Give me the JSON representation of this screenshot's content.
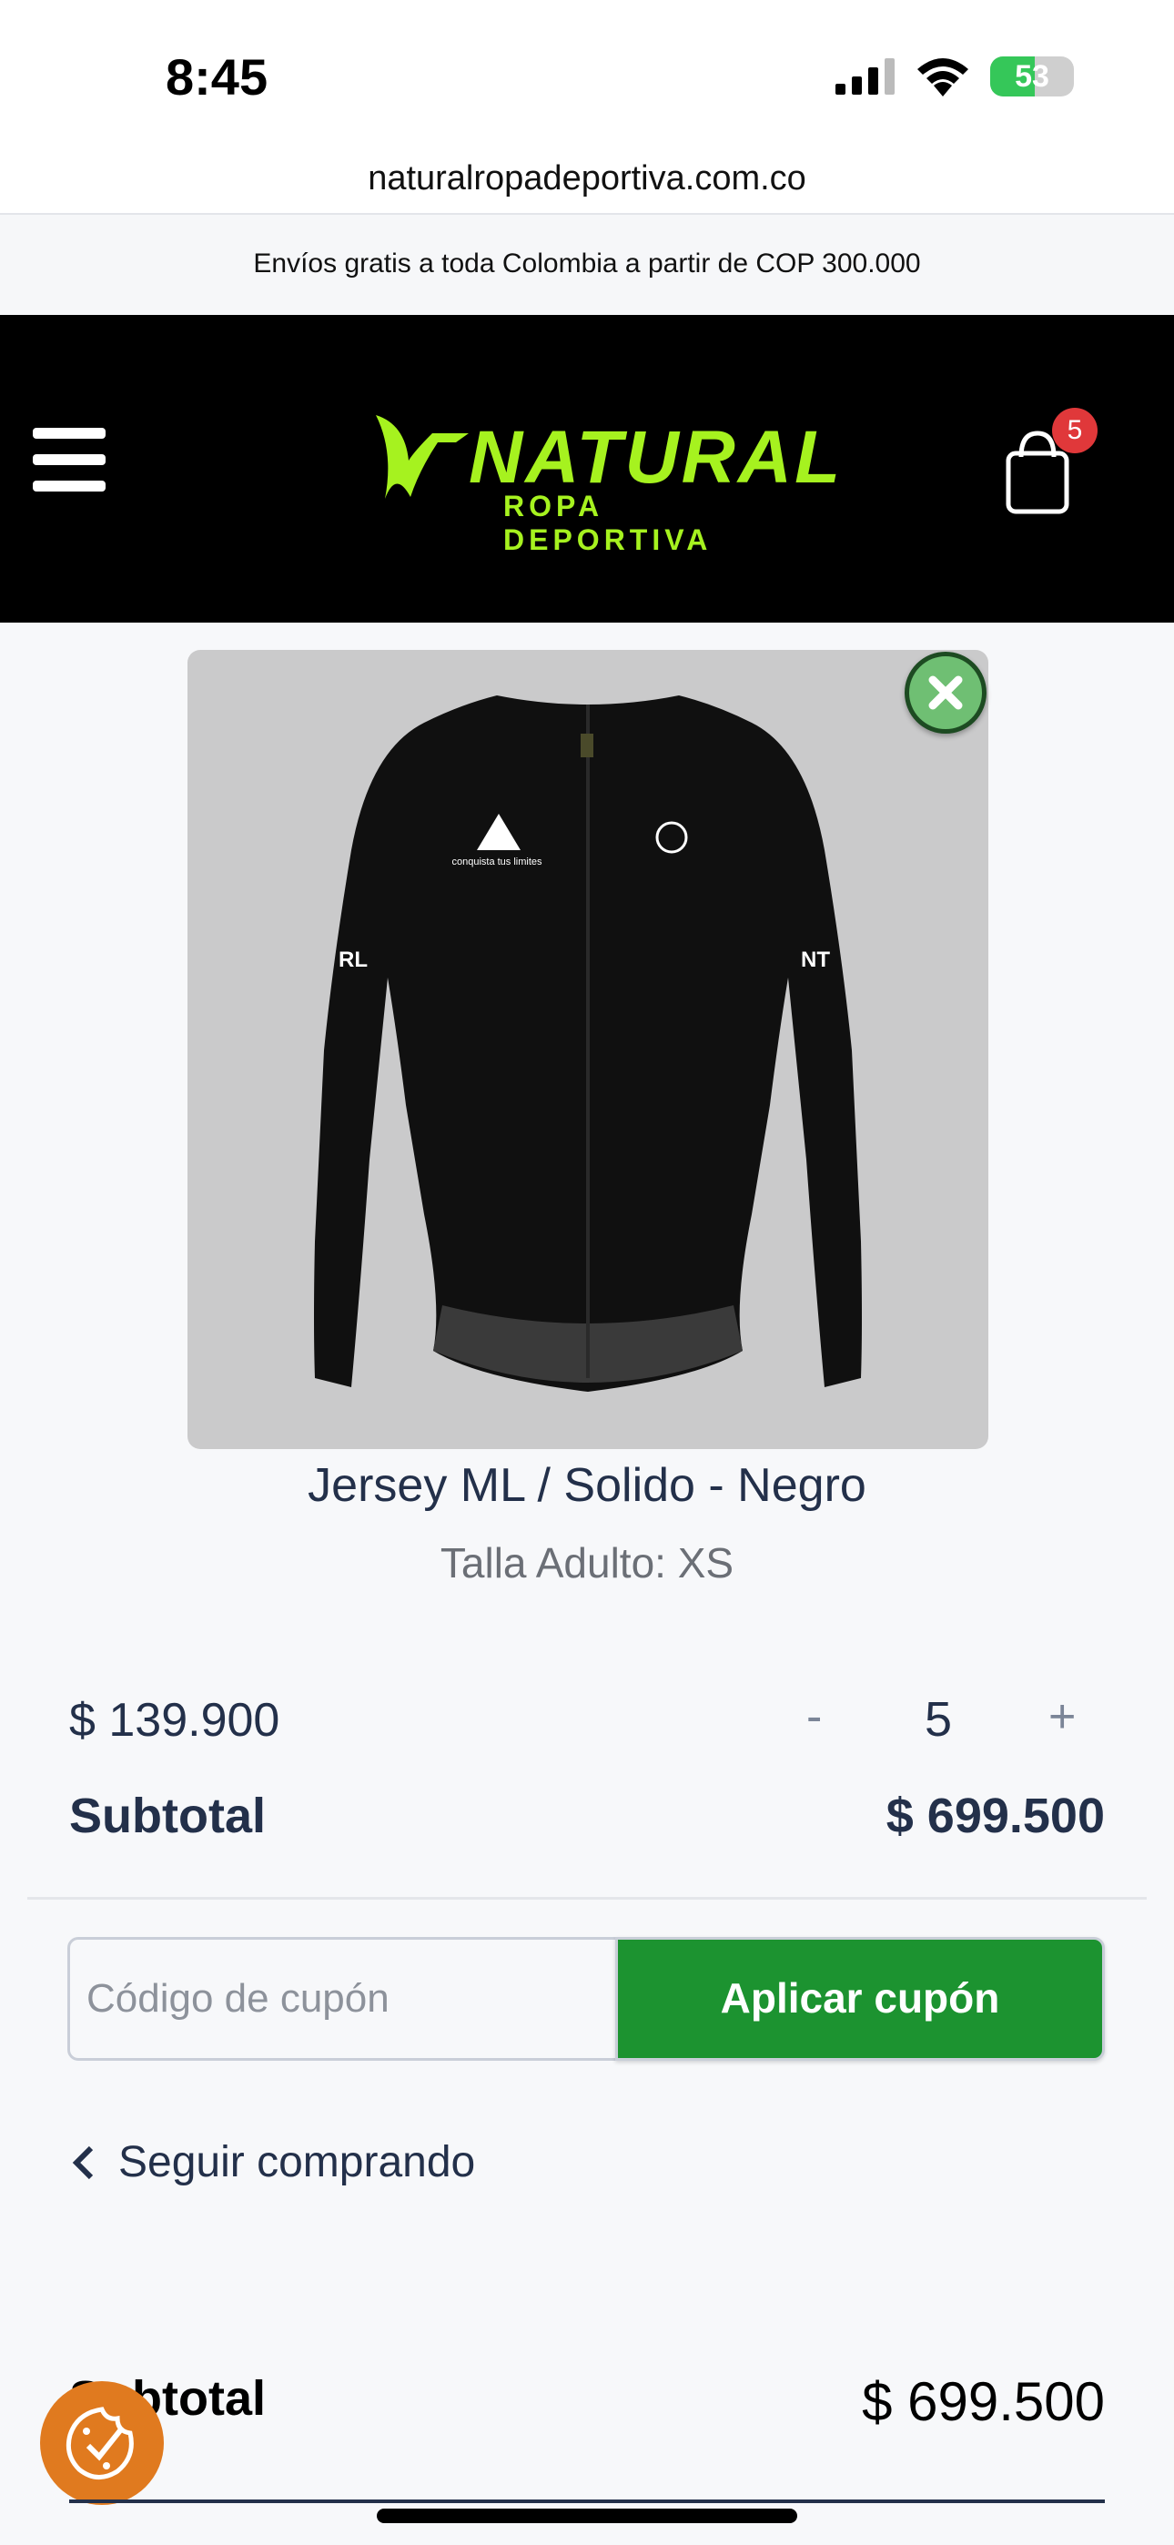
{
  "status_bar": {
    "time": "8:45",
    "battery_percent": "53",
    "battery_level": 0.53
  },
  "browser": {
    "url": "naturalropadeportiva.com.co"
  },
  "promo": {
    "text": "Envíos gratis a toda Colombia a partir de COP 300.000"
  },
  "header": {
    "logo_main": "NATURAL",
    "logo_sub": "ROPA DEPORTIVA",
    "cart_count": "5"
  },
  "colors": {
    "accent_green": "#1c9330",
    "logo_lime": "#a6f21f",
    "badge_red": "#e0383a",
    "cookie_orange": "#e07a1f"
  },
  "cart_item": {
    "name": "Jersey ML / Solido - Negro",
    "variant": "Talla Adulto:  XS",
    "unit_price": "$ 139.900",
    "qty_minus": "-",
    "quantity": "5",
    "qty_plus": "+",
    "subtotal_label": "Subtotal",
    "subtotal_value": "$ 699.500",
    "jersey_chest_text": "conquista tus limites",
    "jersey_sleeve_left": "RL",
    "jersey_sleeve_right": "NT"
  },
  "coupon": {
    "placeholder": "Código de cupón",
    "button_label": "Aplicar cupón"
  },
  "continue_shopping": {
    "label": "Seguir comprando"
  },
  "summary": {
    "subtotal_label": "Subtotal",
    "subtotal_value": "$ 699.500"
  }
}
